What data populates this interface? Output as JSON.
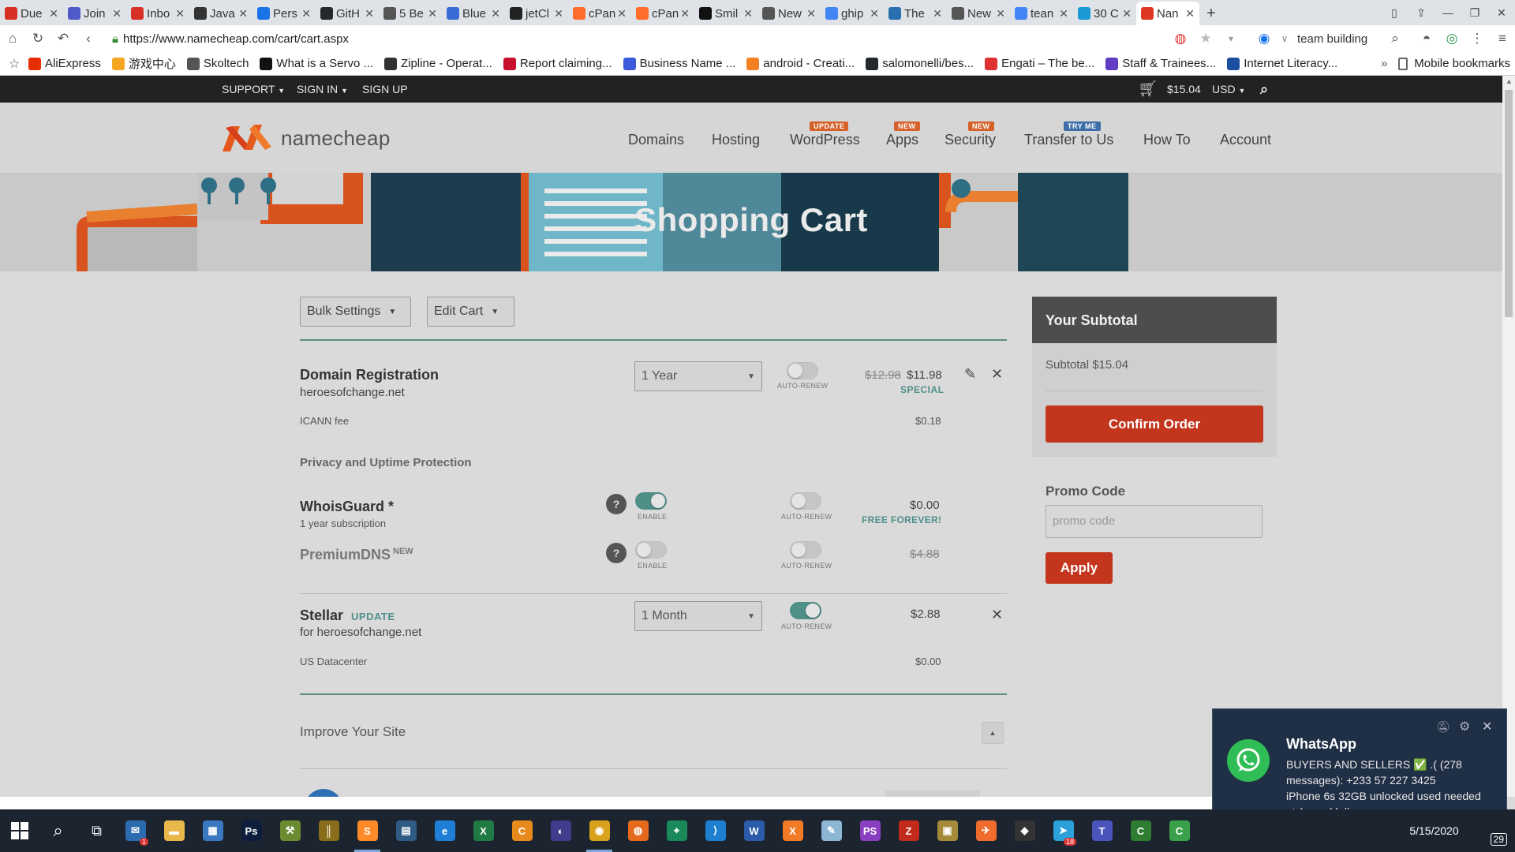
{
  "browser": {
    "tabs": [
      {
        "title": "Due",
        "icon": "gmail-icon",
        "color": "#d93025"
      },
      {
        "title": "Join",
        "icon": "teams-icon",
        "color": "#5059c9"
      },
      {
        "title": "Inbo",
        "icon": "gmail-icon",
        "color": "#d93025"
      },
      {
        "title": "Java",
        "icon": "page-icon",
        "color": "#333333"
      },
      {
        "title": "Pers",
        "icon": "profile-icon",
        "color": "#1a73e8"
      },
      {
        "title": "GitH",
        "icon": "github-icon",
        "color": "#24292e"
      },
      {
        "title": "5 Be",
        "icon": "page-icon",
        "color": "#555555"
      },
      {
        "title": "Blue",
        "icon": "bluehost-icon",
        "color": "#3b6bd6"
      },
      {
        "title": "jetCl",
        "icon": "jet-icon",
        "color": "#222222"
      },
      {
        "title": "cPan",
        "icon": "cpanel-icon",
        "color": "#ff6c2c"
      },
      {
        "title": "cPan",
        "icon": "cpanel-icon",
        "color": "#ff6c2c"
      },
      {
        "title": "Smil",
        "icon": "smile-icon",
        "color": "#111111"
      },
      {
        "title": "New",
        "icon": "page-icon",
        "color": "#555555"
      },
      {
        "title": "ghip",
        "icon": "google-icon",
        "color": "#4285f4"
      },
      {
        "title": "The",
        "icon": "page-icon",
        "color": "#2a6fb0"
      },
      {
        "title": "New",
        "icon": "page-icon",
        "color": "#555555"
      },
      {
        "title": "tean",
        "icon": "google-icon",
        "color": "#4285f4"
      },
      {
        "title": "30 C",
        "icon": "page-icon",
        "color": "#1c9ad6"
      },
      {
        "title": "Nan",
        "icon": "namecheap-icon",
        "color": "#de3723",
        "active": true
      }
    ],
    "new_tab": "+",
    "url": "https://www.namecheap.com/cart/cart.aspx",
    "search_text": "team building",
    "bookmarks": [
      {
        "label": "AliExpress",
        "color": "#e62e04"
      },
      {
        "label": "游戏中心",
        "color": "#f5a623"
      },
      {
        "label": "Skoltech",
        "color": "#555555"
      },
      {
        "label": "What is a Servo ...",
        "color": "#111111"
      },
      {
        "label": "Zipline - Operat...",
        "color": "#333333"
      },
      {
        "label": "Report claiming...",
        "color": "#c8102e"
      },
      {
        "label": "Business Name ...",
        "color": "#3b5bdb"
      },
      {
        "label": "android - Creati...",
        "color": "#f48024"
      },
      {
        "label": "salomonelli/bes...",
        "color": "#24292e"
      },
      {
        "label": "Engati – The be...",
        "color": "#e03131"
      },
      {
        "label": "Staff & Trainees...",
        "color": "#5f3dc4"
      },
      {
        "label": "Internet Literacy...",
        "color": "#1c4fa0"
      }
    ],
    "bookmarks_more": "»",
    "mobile_bookmarks": "Mobile bookmarks"
  },
  "topbar": {
    "support": "SUPPORT",
    "sign_in": "SIGN IN",
    "sign_up": "SIGN UP",
    "cart_total": "$15.04",
    "currency": "USD"
  },
  "header": {
    "logo_text": "namecheap",
    "nav": [
      {
        "label": "Domains"
      },
      {
        "label": "Hosting"
      },
      {
        "label": "WordPress",
        "badge": "UPDATE",
        "badge_color": "#d4622a"
      },
      {
        "label": "Apps",
        "badge": "NEW",
        "badge_color": "#d4622a"
      },
      {
        "label": "Security",
        "badge": "NEW",
        "badge_color": "#d4622a"
      },
      {
        "label": "Transfer to Us",
        "badge": "TRY ME",
        "badge_color": "#3e6fa8"
      },
      {
        "label": "How To"
      },
      {
        "label": "Account"
      }
    ]
  },
  "banner": {
    "title": "Shopping Cart"
  },
  "cart": {
    "bulk_settings": "Bulk Settings",
    "edit_cart": "Edit Cart",
    "domain": {
      "title": "Domain Registration",
      "name": "heroesofchange.net",
      "period": "1 Year",
      "auto_renew": "AUTO-RENEW",
      "old_price": "$12.98",
      "price": "$11.98",
      "special": "SPECIAL",
      "icann_label": "ICANN fee",
      "icann_price": "$0.18"
    },
    "privacy_title": "Privacy and Uptime Protection",
    "whoisguard": {
      "title": "WhoisGuard *",
      "sub": "1 year subscription",
      "enable": "ENABLE",
      "auto_renew": "AUTO-RENEW",
      "price": "$0.00",
      "note": "FREE FOREVER!"
    },
    "premiumdns": {
      "title": "PremiumDNS",
      "sup": "NEW",
      "enable": "ENABLE",
      "auto_renew": "AUTO-RENEW",
      "price": "$4.88"
    },
    "stellar": {
      "title": "Stellar",
      "update": "UPDATE",
      "sub": "for heroesofchange.net",
      "period": "1 Month",
      "auto_renew": "AUTO-RENEW",
      "price": "$2.88",
      "datacenter_label": "US Datacenter",
      "datacenter_price": "$0.00"
    },
    "improve": "Improve Your Site"
  },
  "sidebar": {
    "subtotal_title": "Your Subtotal",
    "subtotal_line": "Subtotal $15.04",
    "confirm": "Confirm Order",
    "promo_title": "Promo Code",
    "promo_placeholder": "promo code",
    "apply": "Apply"
  },
  "toast": {
    "app": "WhatsApp",
    "line1": "BUYERS AND SELLERS ✅ .( (278",
    "line2": "messages): +233 57 227 3425",
    "line3": "iPhone 6s 32GB unlocked used needed",
    "line4": "at Accra Mall"
  },
  "taskbar": {
    "icons": [
      {
        "name": "mail-icon",
        "color": "#2b6cb0",
        "glyph": "✉",
        "badge": "1"
      },
      {
        "name": "file-explorer-icon",
        "color": "#e8b84a",
        "glyph": "▬"
      },
      {
        "name": "store-icon",
        "color": "#3a78c2",
        "glyph": "▦"
      },
      {
        "name": "photoshop-icon",
        "color": "#0d1f3c",
        "glyph": "Ps"
      },
      {
        "name": "tools-icon",
        "color": "#6a8b2f",
        "glyph": "⚒"
      },
      {
        "name": "equalizer-icon",
        "color": "#8a6d1a",
        "glyph": "║"
      },
      {
        "name": "sublime-icon",
        "color": "#ff8a2a",
        "glyph": "S",
        "running": true
      },
      {
        "name": "calculator-icon",
        "color": "#2f5b85",
        "glyph": "▤"
      },
      {
        "name": "edge-icon",
        "color": "#1f7fd6",
        "glyph": "e"
      },
      {
        "name": "excel-icon",
        "color": "#1f7a43",
        "glyph": "X"
      },
      {
        "name": "cursor-icon",
        "color": "#e68a1c",
        "glyph": "C"
      },
      {
        "name": "eclipse-icon",
        "color": "#3f3d8c",
        "glyph": "◐"
      },
      {
        "name": "chrome-icon",
        "color": "#d9a21c",
        "glyph": "◉",
        "running": true
      },
      {
        "name": "firefox-icon",
        "color": "#e56a1c",
        "glyph": "◍"
      },
      {
        "name": "maps-icon",
        "color": "#1b8a5a",
        "glyph": "⌖"
      },
      {
        "name": "vscode-icon",
        "color": "#1e7fd0",
        "glyph": "⟩"
      },
      {
        "name": "word-icon",
        "color": "#2b5aa8",
        "glyph": "W"
      },
      {
        "name": "xampp-icon",
        "color": "#f07a26",
        "glyph": "X"
      },
      {
        "name": "notepad-icon",
        "color": "#8cb8d6",
        "glyph": "✎"
      },
      {
        "name": "phpstorm-icon",
        "color": "#8a3fc0",
        "glyph": "PS"
      },
      {
        "name": "filezilla-icon",
        "color": "#c22a1c",
        "glyph": "Z"
      },
      {
        "name": "archive-icon",
        "color": "#a58a3a",
        "glyph": "▣"
      },
      {
        "name": "postman-icon",
        "color": "#ef6c2c",
        "glyph": "✈"
      },
      {
        "name": "shield-icon",
        "color": "#333333",
        "glyph": "◆"
      },
      {
        "name": "telegram-icon",
        "color": "#2aa1da",
        "glyph": "➤",
        "badge": "18"
      },
      {
        "name": "teams-icon",
        "color": "#4b53bc",
        "glyph": "T"
      },
      {
        "name": "camtasia-icon",
        "color": "#2e7d32",
        "glyph": "C"
      },
      {
        "name": "camtasia-rec-icon",
        "color": "#3aa04a",
        "glyph": "C"
      }
    ],
    "date": "5/15/2020",
    "notif_count": "29"
  }
}
